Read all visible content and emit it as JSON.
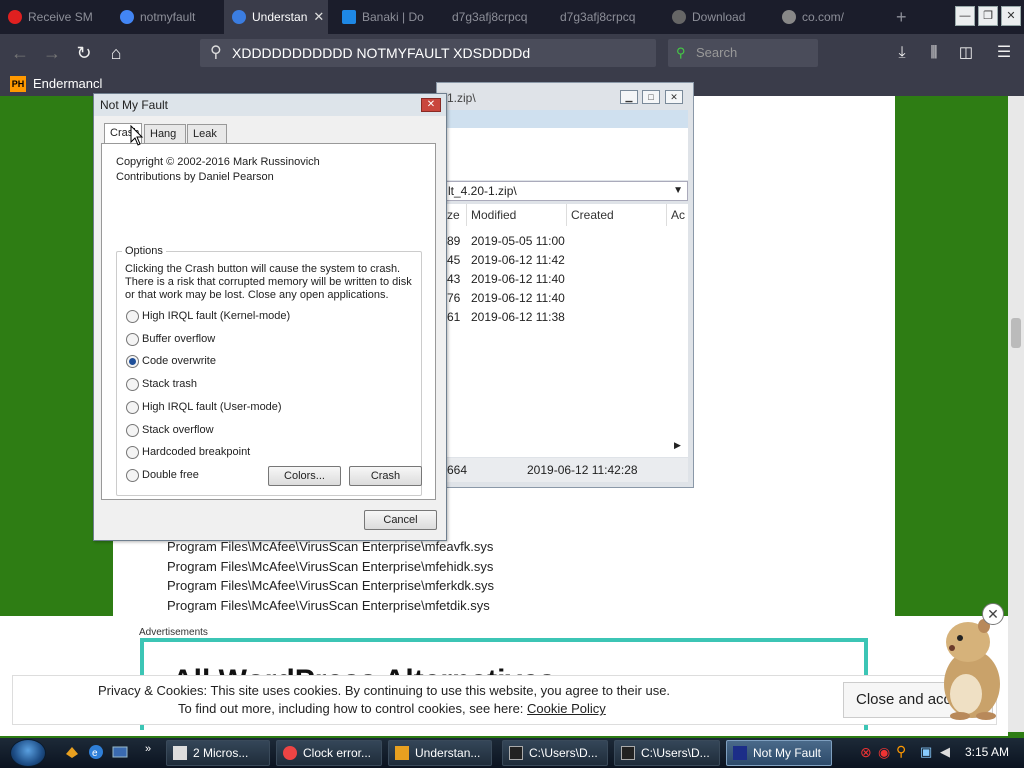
{
  "browser": {
    "tabs": [
      {
        "label": "Receive SM",
        "color": "#e02020"
      },
      {
        "label": "notmyfault",
        "color": "#4285f4"
      },
      {
        "label": "Understan",
        "color": "#3b7de0"
      },
      {
        "label": "Banaki | Do",
        "color": "#1e88e5"
      },
      {
        "label": "d7g3afj8crpcq",
        "color": ""
      },
      {
        "label": "d7g3afj8crpcq",
        "color": ""
      },
      {
        "label": "Download",
        "color": "#666666"
      },
      {
        "label": "co.com/",
        "color": "#888888"
      }
    ],
    "new_tab": "+",
    "url": "XDDDDDDDDDDD NOTMYFAULT XDSDDDDd",
    "search_placeholder": "Search",
    "bookmark_badge": "PH",
    "bookmark": "Endermancl"
  },
  "zip_window": {
    "title": "-1.zip\\",
    "path": "lt_4.20-1.zip\\",
    "columns": [
      "ze",
      "Modified",
      "Created",
      "Ac"
    ],
    "rows": [
      {
        "size": "89",
        "modified": "2019-05-05 11:00"
      },
      {
        "size": "45",
        "modified": "2019-06-12 11:42"
      },
      {
        "size": "43",
        "modified": "2019-06-12 11:40"
      },
      {
        "size": "76",
        "modified": "2019-06-12 11:40"
      },
      {
        "size": "61",
        "modified": "2019-06-12 11:38"
      }
    ],
    "status_size": "664",
    "status_date": "2019-06-12 11:42:28"
  },
  "dialog": {
    "title": "Not My Fault",
    "tabs": [
      "Crash",
      "Hang",
      "Leak"
    ],
    "copyright": "Copyright © 2002-2016 Mark Russinovich",
    "contributions": "Contributions by Daniel Pearson",
    "options_label": "Options",
    "description": [
      "Clicking the Crash button will cause the system to crash.",
      "There is a risk that corrupted memory will be written to disk",
      "or that work may be lost. Close any open applications."
    ],
    "options": [
      {
        "label": "High IRQL fault (Kernel-mode)",
        "checked": false
      },
      {
        "label": "Buffer overflow",
        "checked": false
      },
      {
        "label": "Code overwrite",
        "checked": true
      },
      {
        "label": "Stack trash",
        "checked": false
      },
      {
        "label": "High IRQL fault (User-mode)",
        "checked": false
      },
      {
        "label": "Stack overflow",
        "checked": false
      },
      {
        "label": "Hardcoded breakpoint",
        "checked": false
      },
      {
        "label": "Double free",
        "checked": false
      }
    ],
    "colors_button": "Colors...",
    "crash_button": "Crash",
    "cancel_button": "Cancel"
  },
  "page": {
    "lines": [
      "Program Files\\McAfee\\VirusScan Enterprise\\mfeavfk.sys",
      "Program Files\\McAfee\\VirusScan Enterprise\\mfehidk.sys",
      "Program Files\\McAfee\\VirusScan Enterprise\\mferkdk.sys",
      "Program Files\\McAfee\\VirusScan Enterprise\\mfetdik.sys"
    ],
    "ad_label": "Advertisements",
    "ad_text": "All WordPress Alternatives"
  },
  "cookie": {
    "line1": "Privacy & Cookies: This site uses cookies. By continuing to use this website, you agree to their use.",
    "line2": "To find out more, including how to control cookies, see here:",
    "link": "Cookie Policy",
    "button": "Close and accept"
  },
  "taskbar": {
    "buttons": [
      {
        "label": "2 Micros...",
        "active": false
      },
      {
        "label": "Clock error...",
        "active": false
      },
      {
        "label": "Understan...",
        "active": false
      },
      {
        "label": "C:\\Users\\D...",
        "active": false
      },
      {
        "label": "C:\\Users\\D...",
        "active": false
      },
      {
        "label": "Not My Fault",
        "active": true
      }
    ],
    "clock": "3:15 AM"
  }
}
